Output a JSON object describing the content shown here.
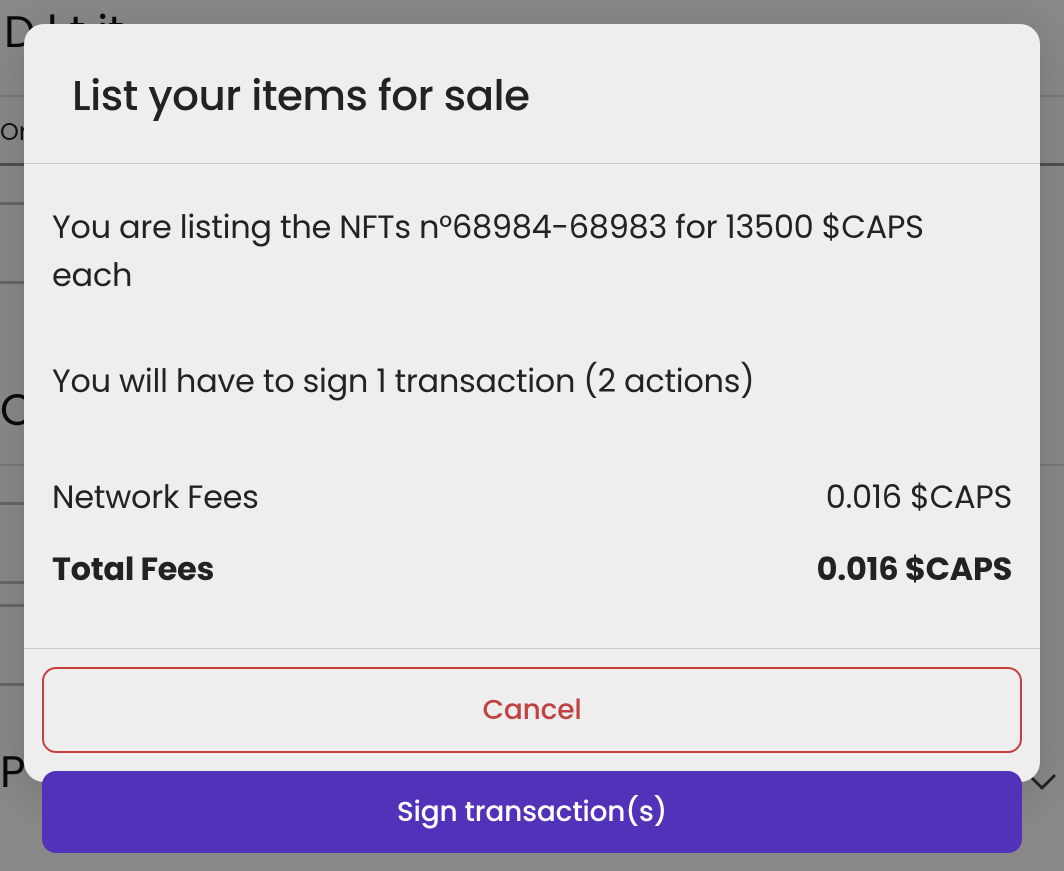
{
  "background": {
    "heading1_fragment": "D  l            t                            it",
    "label_on": "On",
    "letter_c": "C",
    "letter_p": "P"
  },
  "modal": {
    "title": "List your items for sale",
    "listing_summary": "You are listing the NFTs n°68984-68983 for 13500 $CAPS each",
    "transaction_summary": "You will have to sign 1 transaction (2 actions)",
    "fees": {
      "network_label": "Network Fees",
      "network_value": "0.016 $CAPS",
      "total_label": "Total Fees",
      "total_value": "0.016 $CAPS"
    },
    "buttons": {
      "cancel": "Cancel",
      "sign": "Sign transaction(s)"
    }
  }
}
